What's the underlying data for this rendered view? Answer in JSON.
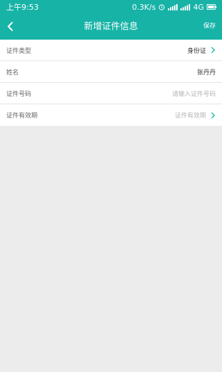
{
  "status": {
    "time": "上午9:53",
    "speed": "0.3K/s",
    "network": "4G"
  },
  "nav": {
    "title": "新增证件信息",
    "save_label": "保存"
  },
  "form": {
    "rows": [
      {
        "label": "证件类型",
        "value": "身份证"
      },
      {
        "label": "姓名",
        "value": "张丹丹"
      },
      {
        "label": "证件号码",
        "placeholder": "请输入证件号码"
      },
      {
        "label": "证件有效期",
        "placeholder": "证件有效期"
      }
    ]
  },
  "colors": {
    "primary": "#17b3a7",
    "chevron": "#17b3a7"
  },
  "icons": [
    "back-arrow-icon",
    "alarm-icon",
    "signal-icon",
    "battery-icon",
    "chevron-right-icon"
  ]
}
